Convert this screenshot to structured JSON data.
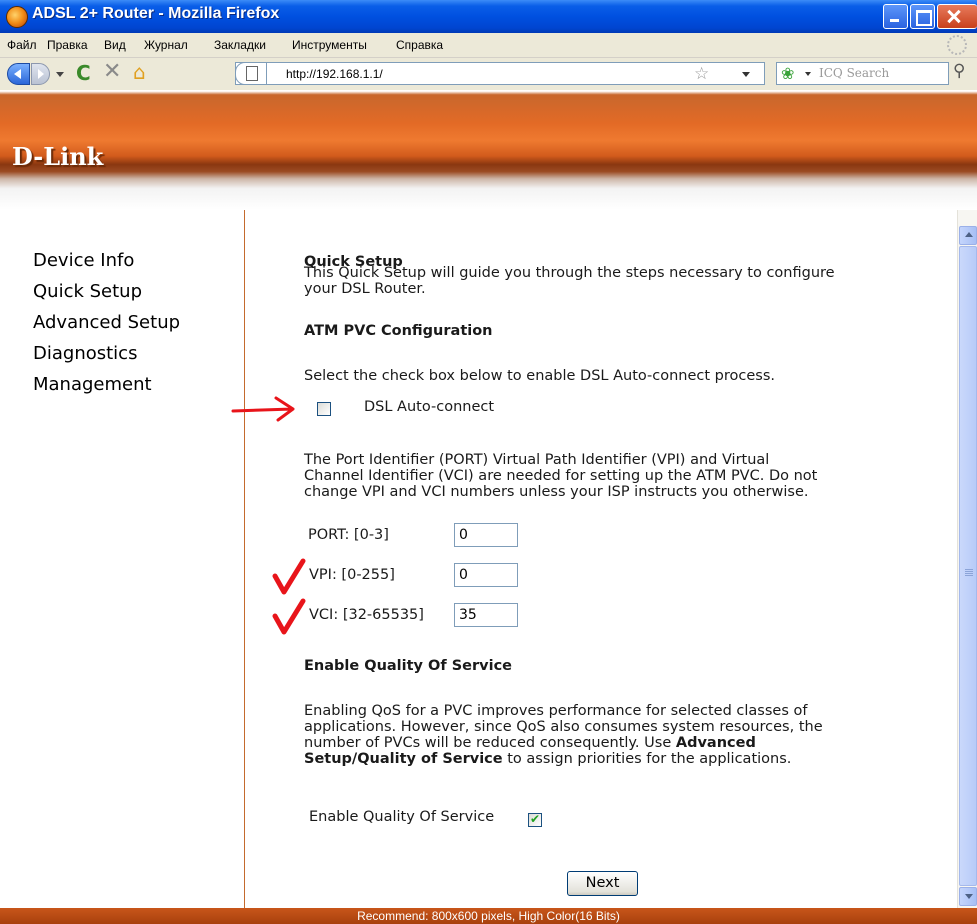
{
  "window": {
    "title": "ADSL 2+ Router - Mozilla Firefox"
  },
  "menu": {
    "items": [
      "Файл",
      "Правка",
      "Вид",
      "Журнал",
      "Закладки",
      "Инструменты",
      "Справка"
    ]
  },
  "toolbar": {
    "url": "http://192.168.1.1/",
    "search_placeholder": "ICQ Search"
  },
  "brand": {
    "logo": "D-Link"
  },
  "sidebar": {
    "items": [
      "Device Info",
      "Quick Setup",
      "Advanced Setup",
      "Diagnostics",
      "Management"
    ]
  },
  "content": {
    "title": "Quick Setup",
    "intro_line1": "This Quick Setup will guide you through the steps necessary to configure",
    "intro_line2": "your DSL Router.",
    "atm_heading": "ATM PVC Configuration",
    "auto_instruction": "Select the check box below to enable DSL Auto-connect process.",
    "auto_label": "DSL Auto-connect",
    "auto_checked": false,
    "pvc_line1": "The Port Identifier (PORT) Virtual Path Identifier (VPI) and Virtual",
    "pvc_line2": "Channel Identifier (VCI) are needed for setting up the ATM PVC. Do not",
    "pvc_line3": "change VPI and VCI numbers unless your ISP instructs you otherwise.",
    "fields": {
      "port_label": "PORT: [0-3]",
      "port_value": "0",
      "vpi_label": "VPI: [0-255]",
      "vpi_value": "0",
      "vci_label": "VCI: [32-65535]",
      "vci_value": "35"
    },
    "qos_heading": "Enable Quality Of Service",
    "qos_line1": "Enabling QoS for a PVC improves performance for selected classes of",
    "qos_line2": "applications. However, since QoS also consumes system resources, the",
    "qos_line3": "number of PVCs will be reduced consequently. Use",
    "qos_bold_a": "Advanced",
    "qos_bold_b": "Setup/Quality of Service",
    "qos_line4_rest": " to assign priorities for the applications.",
    "qos_label": "Enable Quality Of Service",
    "qos_checked": true,
    "next_label": "Next"
  },
  "footer": {
    "text": "Recommend: 800x600 pixels, High Color(16 Bits)"
  },
  "annotation_color": "#e8141a"
}
